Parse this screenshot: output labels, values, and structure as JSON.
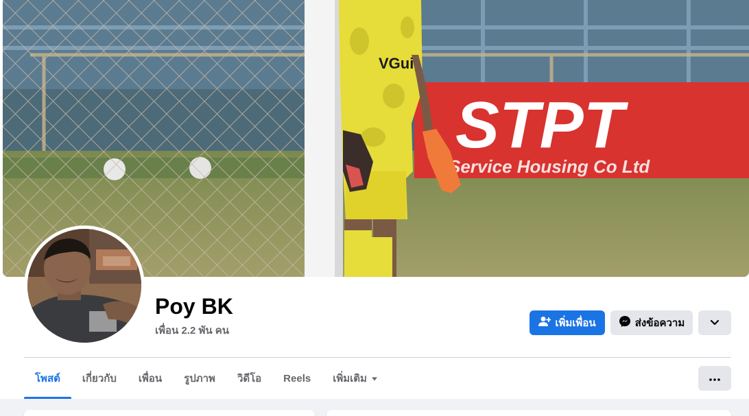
{
  "profile": {
    "name": "Poy BK",
    "friends_count": "เพื่อน 2.2 พัน คน"
  },
  "cover": {
    "banner_text": "STPT",
    "banner_subtext": "Service Housing Co Ltd",
    "jersey_text": "VGuit"
  },
  "actions": {
    "add_friend_label": "เพิ่มเพื่อน",
    "message_label": "ส่งข้อความ",
    "add_friend_icon": "add-user-icon",
    "message_icon": "messenger-icon",
    "expand_icon": "chevron-down-icon",
    "more_icon": "more-dots-icon"
  },
  "tabs": [
    {
      "label": "โพสต์",
      "active": true
    },
    {
      "label": "เกี่ยวกับ",
      "active": false
    },
    {
      "label": "เพื่อน",
      "active": false
    },
    {
      "label": "รูปภาพ",
      "active": false
    },
    {
      "label": "วิดีโอ",
      "active": false
    },
    {
      "label": "Reels",
      "active": false
    },
    {
      "label": "เพิ่มเติม",
      "active": false
    }
  ],
  "colors": {
    "accent": "#1b74e4",
    "secondary_button": "#e4e6eb",
    "background": "#f0f2f5"
  }
}
